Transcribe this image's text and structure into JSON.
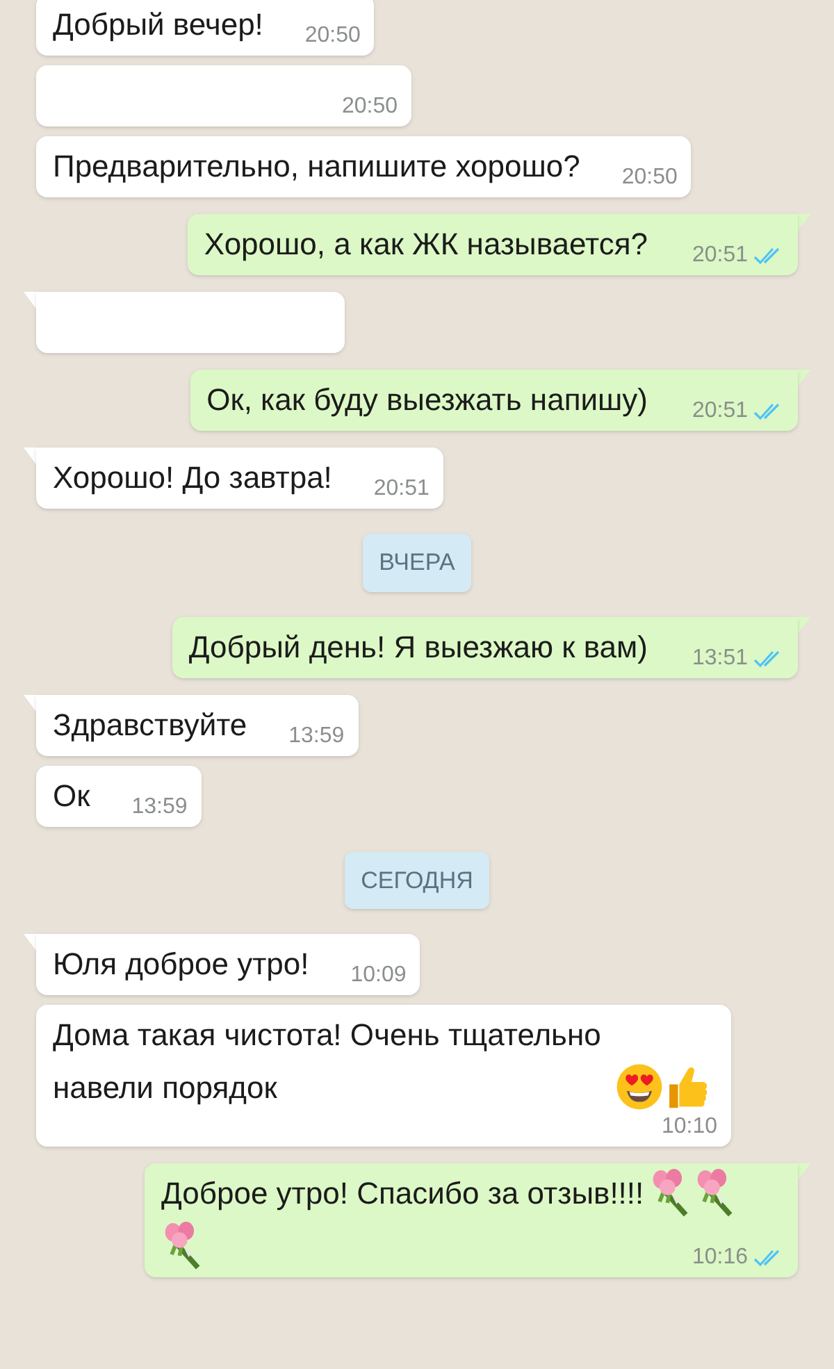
{
  "messages": [
    {
      "kind": "received",
      "text": "Добрый вечер!",
      "time": "20:50"
    },
    {
      "kind": "received",
      "tail": false,
      "time": "20:50"
    },
    {
      "kind": "received",
      "tail": false,
      "text": "Предварительно, напишите хорошо?",
      "time": "20:50"
    },
    {
      "kind": "sent",
      "tail": true,
      "text": "Хорошо, а как ЖК называется?",
      "time": "20:51",
      "read": true
    },
    {
      "kind": "received",
      "tail": true
    },
    {
      "kind": "sent",
      "tail": true,
      "text": "Ок, как буду выезжать напишу)",
      "time": "20:51",
      "read": true
    },
    {
      "kind": "received",
      "tail": true,
      "text": "Хорошо! До завтра!",
      "time": "20:51"
    },
    {
      "kind": "date",
      "text": "ВЧЕРА"
    },
    {
      "kind": "sent",
      "tail": true,
      "text": "Добрый день! Я выезжаю к вам)",
      "time": "13:51",
      "read": true
    },
    {
      "kind": "received",
      "tail": true,
      "text": "Здравствуйте",
      "time": "13:59"
    },
    {
      "kind": "received",
      "tail": false,
      "text": "Ок",
      "time": "13:59"
    },
    {
      "kind": "date",
      "text": "СЕГОДНЯ"
    },
    {
      "kind": "received",
      "tail": true,
      "text": "Юля доброе утро!",
      "time": "10:09"
    },
    {
      "kind": "received",
      "tail": false,
      "text": "Дома такая чистота! Очень тщательно навели порядок",
      "emojis": [
        {
          "kind": "heart_eyes"
        },
        {
          "kind": "thumbs_up"
        }
      ],
      "time": "10:10"
    },
    {
      "kind": "sent",
      "tail": true,
      "text": "Доброе утро! Спасибо за отзыв!!!!",
      "emojis": [
        {
          "kind": "bouquet"
        },
        {
          "kind": "bouquet"
        },
        {
          "kind": "bouquet"
        }
      ],
      "time": "10:16",
      "read": true
    }
  ]
}
